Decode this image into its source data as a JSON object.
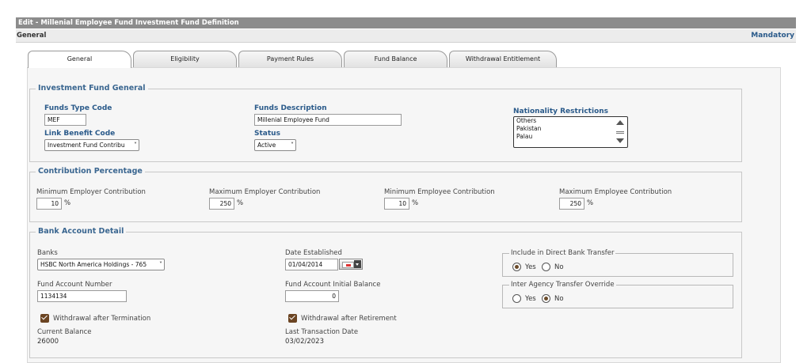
{
  "window": {
    "title": "Edit - Millenial Employee Fund Investment Fund Definition"
  },
  "section": {
    "name": "General",
    "mandatory": "Mandatory"
  },
  "tabs": [
    {
      "label": "General"
    },
    {
      "label": "Eligibility"
    },
    {
      "label": "Payment Rules"
    },
    {
      "label": "Fund Balance"
    },
    {
      "label": "Withdrawal Entitlement"
    }
  ],
  "investment_fund_general": {
    "legend": "Investment Fund General",
    "funds_type_code_label": "Funds Type Code",
    "funds_type_code_value": "MEF",
    "funds_description_label": "Funds Description",
    "funds_description_value": "Millenial Employee Fund",
    "link_benefit_code_label": "Link Benefit Code",
    "link_benefit_code_value": "Investment Fund Contribu",
    "status_label": "Status",
    "status_value": "Active",
    "nationality_label": "Nationality Restrictions",
    "nationality_options": [
      "Others",
      "Pakistan",
      "Palau"
    ]
  },
  "contribution_percentage": {
    "legend": "Contribution Percentage",
    "min_employer_label": "Minimum Employer Contribution",
    "min_employer_value": "10",
    "max_employer_label": "Maximum Employer Contribution",
    "max_employer_value": "250",
    "min_employee_label": "Minimum Employee Contribution",
    "min_employee_value": "10",
    "max_employee_label": "Maximum Employee Contribution",
    "max_employee_value": "250",
    "pct_symbol": "%"
  },
  "bank_account_detail": {
    "legend": "Bank Account Detail",
    "banks_label": "Banks",
    "banks_value": "HSBC North America Holdings - 765",
    "date_established_label": "Date Established",
    "date_established_value": "01/04/2014",
    "include_direct_label": "Include in Direct Bank Transfer",
    "yes": "Yes",
    "no": "No",
    "include_direct_selected": "Yes",
    "fund_account_number_label": "Fund Account Number",
    "fund_account_number_value": "1134134",
    "initial_balance_label": "Fund Account Initial Balance",
    "initial_balance_value": "0",
    "inter_agency_label": "Inter Agency Transfer Override",
    "inter_agency_selected": "No",
    "withdrawal_termination_label": "Withdrawal after Termination",
    "withdrawal_retirement_label": "Withdrawal after Retirement",
    "current_balance_label": "Current Balance",
    "current_balance_value": "26000",
    "last_transaction_label": "Last Transaction Date",
    "last_transaction_value": "03/02/2023"
  }
}
